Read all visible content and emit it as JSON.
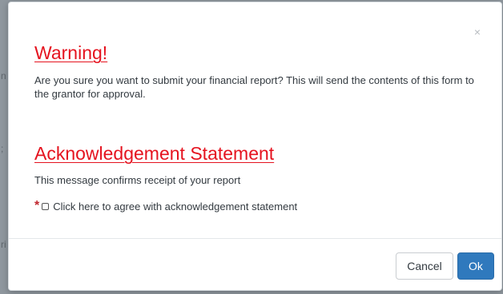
{
  "background": {
    "edge_glyphs": [
      "n",
      ";",
      "ri"
    ]
  },
  "dialog": {
    "close_icon": "×",
    "warning": {
      "title": "Warning!",
      "message": "Are you sure you want to submit your financial report? This will send the contents of this form to the grantor for approval."
    },
    "acknowledgement": {
      "title": "Acknowledgement Statement",
      "message": "This message confirms receipt of your report",
      "required_marker": "*",
      "checkbox_label": "Click here to agree with acknowledgement statement",
      "checked": false
    },
    "buttons": {
      "cancel_label": "Cancel",
      "ok_label": "Ok"
    }
  },
  "colors": {
    "heading": "#e5131f",
    "primary_button": "#2f79bd",
    "required_marker": "#c0262d"
  }
}
